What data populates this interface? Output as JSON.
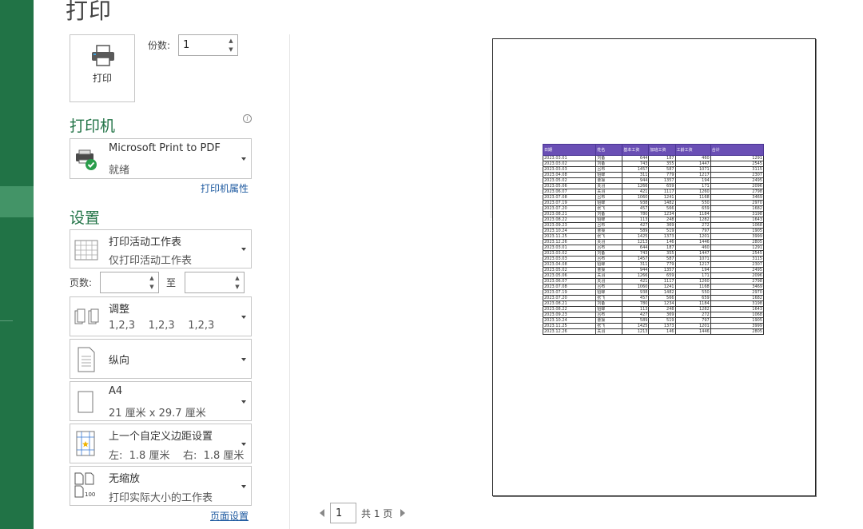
{
  "title": "打印",
  "print_button": {
    "label": "打印"
  },
  "copies": {
    "label": "份数:",
    "value": "1"
  },
  "printer": {
    "heading": "打印机",
    "name": "Microsoft Print to PDF",
    "status": "就绪",
    "properties_link": "打印机属性"
  },
  "settings": {
    "heading": "设置",
    "scope": {
      "line1": "打印活动工作表",
      "line2": "仅打印活动工作表"
    },
    "pages_label": "页数:",
    "to_label": "至",
    "collate": {
      "line1": "调整",
      "line2": "1,2,3    1,2,3    1,2,3"
    },
    "orientation": {
      "line1": "纵向"
    },
    "paper": {
      "line1": "A4",
      "line2": "21 厘米 x 29.7 厘米"
    },
    "margins": {
      "line1": "上一个自定义边距设置",
      "line2": "左:  1.8 厘米    右:  1.8 厘米"
    },
    "scaling": {
      "line1": "无缩放",
      "line2": "打印实际大小的工作表"
    },
    "page_setup_link": "页面设置"
  },
  "pager": {
    "current": "1",
    "total_text": "共 1 页"
  },
  "colors": {
    "accent": "#217346",
    "header": "#6a4fb5",
    "link": "#1e5aa0"
  },
  "sheet": {
    "headers": [
      "日期",
      "姓名",
      "基本工资",
      "加班工资",
      "工龄工资",
      "合计"
    ],
    "rows": [
      [
        "2023.03.01",
        "刘备",
        "644",
        "187",
        "460",
        "1291"
      ],
      [
        "2023.03.02",
        "刘备",
        "743",
        "355",
        "1447",
        "2545"
      ],
      [
        "2023.03.03",
        "吕布",
        "1457",
        "587",
        "1071",
        "3115"
      ],
      [
        "2023.04.08",
        "貂蝉",
        "311",
        "779",
        "1217",
        "2307"
      ],
      [
        "2023.05.02",
        "曹操",
        "944",
        "1357",
        "194",
        "2495"
      ],
      [
        "2023.05.06",
        "关羽",
        "1266",
        "659",
        "171",
        "2096"
      ],
      [
        "2023.06.07",
        "关羽",
        "421",
        "1117",
        "1260",
        "2798"
      ],
      [
        "2023.07.08",
        "吕布",
        "1060",
        "1241",
        "1168",
        "3469"
      ],
      [
        "2023.07.19",
        "貂蝉",
        "938",
        "1482",
        "550",
        "2970"
      ],
      [
        "2023.07.20",
        "张飞",
        "457",
        "566",
        "659",
        "1682"
      ],
      [
        "2023.08.21",
        "刘备",
        "780",
        "1234",
        "1184",
        "3198"
      ],
      [
        "2023.08.22",
        "貂蝉",
        "113",
        "248",
        "1282",
        "1643"
      ],
      [
        "2023.09.23",
        "吕布",
        "427",
        "369",
        "272",
        "1068"
      ],
      [
        "2023.10.24",
        "曹操",
        "589",
        "519",
        "797",
        "1905"
      ],
      [
        "2023.11.25",
        "张飞",
        "1425",
        "1373",
        "1201",
        "3999"
      ],
      [
        "2023.12.26",
        "关羽",
        "1213",
        "146",
        "1446",
        "2805"
      ],
      [
        "2023.03.01",
        "吕布",
        "644",
        "187",
        "460",
        "1291"
      ],
      [
        "2023.03.02",
        "刘备",
        "743",
        "355",
        "1447",
        "2545"
      ],
      [
        "2023.03.03",
        "吕布",
        "1457",
        "587",
        "1071",
        "3115"
      ],
      [
        "2023.04.08",
        "貂蝉",
        "311",
        "779",
        "1217",
        "2307"
      ],
      [
        "2023.05.02",
        "曹操",
        "944",
        "1357",
        "194",
        "2495"
      ],
      [
        "2023.05.06",
        "关羽",
        "1266",
        "659",
        "171",
        "2096"
      ],
      [
        "2023.06.07",
        "关羽",
        "421",
        "1117",
        "1260",
        "2798"
      ],
      [
        "2023.07.08",
        "吕布",
        "1060",
        "1241",
        "1168",
        "3469"
      ],
      [
        "2023.07.19",
        "貂蝉",
        "938",
        "1482",
        "550",
        "2970"
      ],
      [
        "2023.07.20",
        "张飞",
        "457",
        "566",
        "659",
        "1682"
      ],
      [
        "2023.08.21",
        "刘备",
        "780",
        "1234",
        "1184",
        "3198"
      ],
      [
        "2023.08.22",
        "貂蝉",
        "113",
        "248",
        "1282",
        "1643"
      ],
      [
        "2023.09.23",
        "吕布",
        "427",
        "369",
        "272",
        "1068"
      ],
      [
        "2023.10.24",
        "曹操",
        "589",
        "519",
        "797",
        "1905"
      ],
      [
        "2023.11.25",
        "张飞",
        "1425",
        "1373",
        "1201",
        "3999"
      ],
      [
        "2023.12.26",
        "关羽",
        "1213",
        "146",
        "1446",
        "2805"
      ]
    ]
  }
}
